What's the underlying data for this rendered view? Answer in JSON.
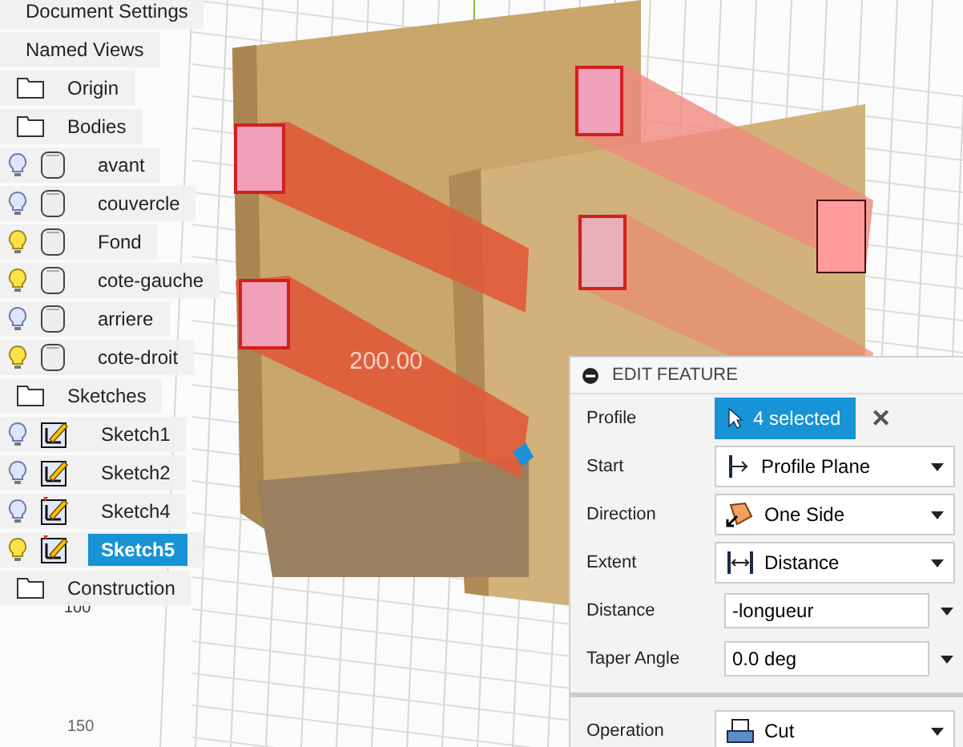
{
  "viewport": {
    "dimension": "200.00",
    "grid_labels": [
      "100",
      "150"
    ]
  },
  "browser": {
    "items": [
      {
        "kind": "header",
        "label": "Document Settings"
      },
      {
        "kind": "header",
        "label": "Named Views"
      },
      {
        "kind": "folder",
        "label": "Origin"
      },
      {
        "kind": "folder",
        "label": "Bodies",
        "children": [
          {
            "kind": "body",
            "label": "avant",
            "visible": false,
            "selected": false
          },
          {
            "kind": "body",
            "label": "couvercle",
            "visible": false,
            "selected": false
          },
          {
            "kind": "body",
            "label": "Fond",
            "visible": true,
            "selected": false
          },
          {
            "kind": "body",
            "label": "cote-gauche",
            "visible": true,
            "selected": false
          },
          {
            "kind": "body",
            "label": "arriere",
            "visible": false,
            "selected": false
          },
          {
            "kind": "body",
            "label": "cote-droit",
            "visible": true,
            "selected": false
          }
        ]
      },
      {
        "kind": "folder",
        "label": "Sketches",
        "children": [
          {
            "kind": "sketch",
            "label": "Sketch1",
            "visible": false,
            "selected": false
          },
          {
            "kind": "sketch",
            "label": "Sketch2",
            "visible": false,
            "selected": false
          },
          {
            "kind": "sketch-warning",
            "label": "Sketch4",
            "visible": false,
            "selected": false
          },
          {
            "kind": "sketch-warning",
            "label": "Sketch5",
            "visible": true,
            "selected": true
          }
        ]
      },
      {
        "kind": "folder",
        "label": "Construction"
      }
    ]
  },
  "edit_feature": {
    "title": "EDIT FEATURE",
    "rows": [
      {
        "kind": "selection",
        "label": "Profile",
        "value": "4 selected",
        "clear": "✕"
      },
      {
        "kind": "dropdown",
        "label": "Start",
        "value": "Profile Plane"
      },
      {
        "kind": "dropdown",
        "label": "Direction",
        "value": "One Side"
      },
      {
        "kind": "dropdown",
        "label": "Extent",
        "value": "Distance"
      },
      {
        "kind": "input",
        "label": "Distance",
        "value": "-longueur"
      },
      {
        "kind": "input",
        "label": "Taper Angle",
        "value": "0.0 deg"
      },
      {
        "kind": "divider"
      },
      {
        "kind": "dropdown",
        "label": "Operation",
        "value": "Cut"
      }
    ]
  }
}
